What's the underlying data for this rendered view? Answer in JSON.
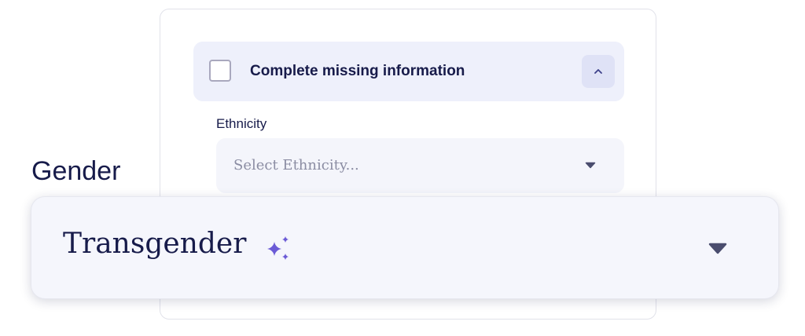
{
  "missing_info_section": {
    "title": "Complete missing information",
    "checked": false,
    "collapse_icon": "chevron-up-icon"
  },
  "ethnicity_field": {
    "label": "Ethnicity",
    "placeholder": "Select Ethnicity...",
    "dropdown_icon": "caret-down-icon"
  },
  "gender_field": {
    "label": "Gender",
    "value": "Transgender",
    "ai_icon": "sparkle-icon",
    "dropdown_icon": "caret-down-icon"
  },
  "colors": {
    "text_primary": "#171b4a",
    "accent_sparkle": "#6b5bd6",
    "header_background": "#eef0fb",
    "field_background": "#f4f5fb",
    "caret": "#4a4d6e"
  }
}
